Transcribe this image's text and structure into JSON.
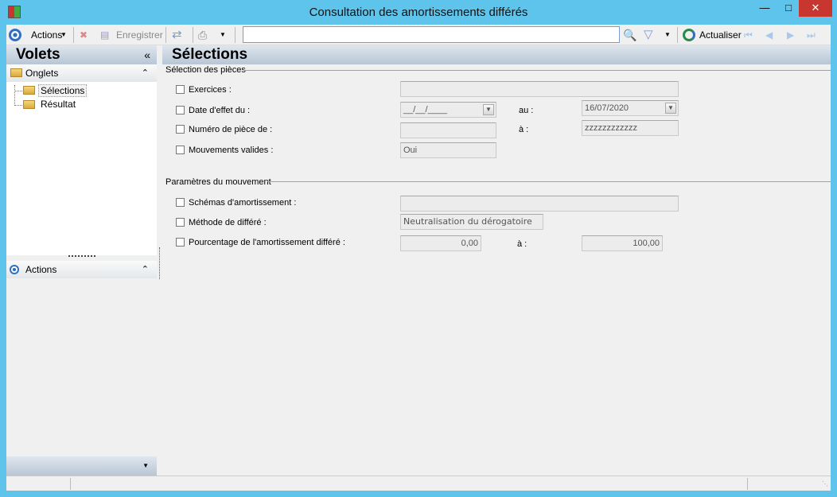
{
  "window": {
    "title": "Consultation des amortissements différés"
  },
  "toolbar": {
    "actions": "Actions",
    "save": "Enregistrer",
    "refresh": "Actualiser",
    "search_value": ""
  },
  "left": {
    "title": "Volets",
    "tabs_header": "Onglets",
    "tree": [
      "Sélections",
      "Résultat"
    ],
    "actions_header": "Actions"
  },
  "main": {
    "title": "Sélections",
    "group1": "Sélection des pièces",
    "exercices": {
      "label": "Exercices :",
      "value": ""
    },
    "date": {
      "label": "Date d'effet du :",
      "from": "__/__/____",
      "to_label": "au :",
      "to": "16/07/2020"
    },
    "piece": {
      "label": "Numéro de pièce de :",
      "from": "",
      "to_label": "à :",
      "to": "zzzzzzzzzzzz"
    },
    "valides": {
      "label": "Mouvements valides :",
      "value": "Oui"
    },
    "group2": "Paramètres du mouvement",
    "schemas": {
      "label": "Schémas d'amortissement :",
      "value": ""
    },
    "methode": {
      "label": "Méthode de différé :",
      "value": "Neutralisation du dérogatoire"
    },
    "pct": {
      "label": "Pourcentage de l'amortissement différé :",
      "from": "0,00",
      "to_label": "à :",
      "to": "100,00"
    }
  }
}
